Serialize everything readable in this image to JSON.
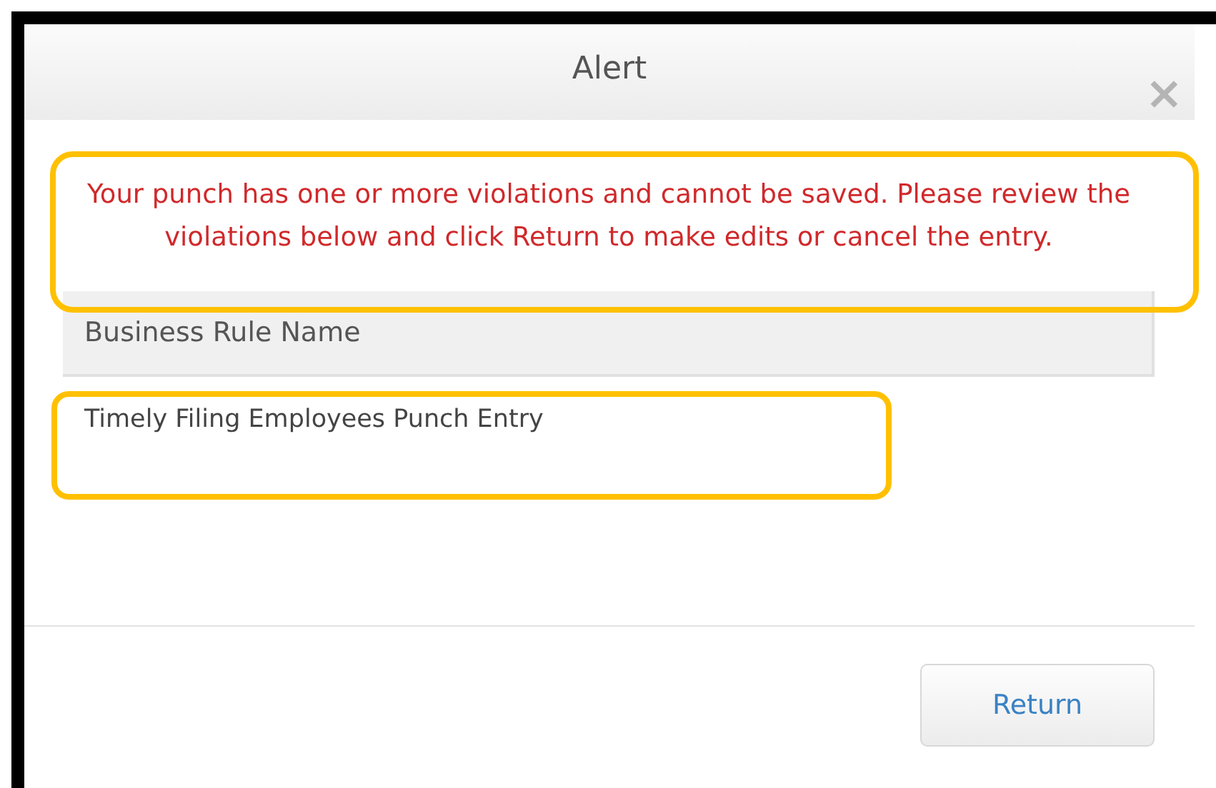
{
  "dialog": {
    "title": "Alert",
    "close": "×"
  },
  "message": {
    "text": "Your punch has one or more violations and cannot be saved. Please review the violations below and click Return to make edits or cancel the entry.",
    "highlighted": true
  },
  "table": {
    "columns": [
      "Business Rule Name"
    ],
    "rows": [
      {
        "cells": [
          "Timely Filing Employees Punch Entry"
        ],
        "highlighted": true
      }
    ]
  },
  "buttons": [
    "Return"
  ]
}
